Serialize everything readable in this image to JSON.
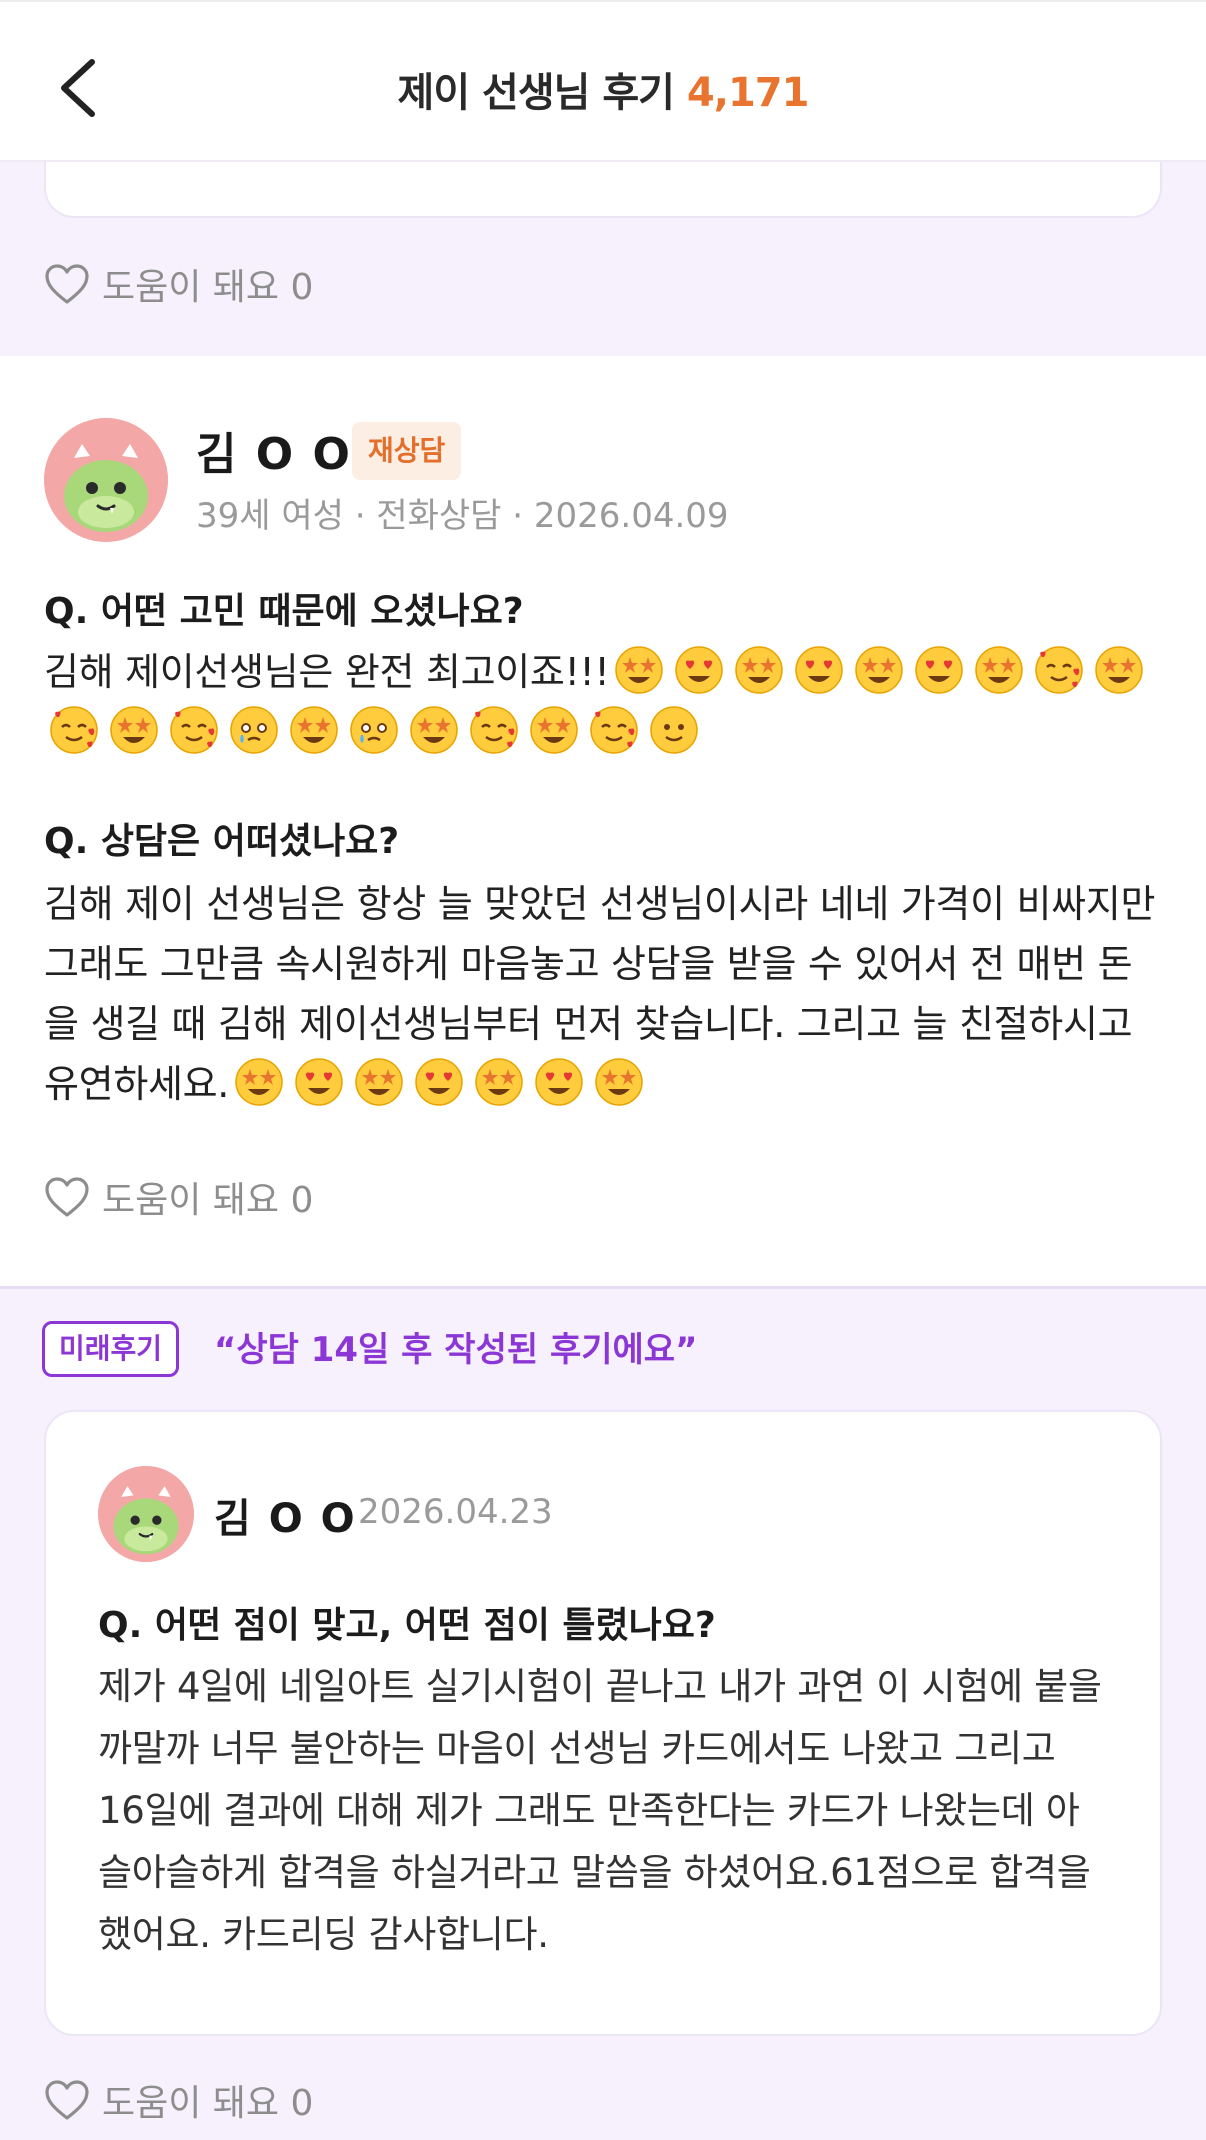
{
  "header": {
    "title": "제이 선생님 후기",
    "count": "4,171"
  },
  "prev_review": {
    "helpful_label": "도움이 돼요 0"
  },
  "review": {
    "name": "김 O O",
    "badge": "재상담",
    "meta": "39세 여성 · 전화상담 · 2026.04.09",
    "q1": "Q. 어떤 고민 때문에 오셨나요?",
    "a1": "김해 제이선생님은 완전 최고이죠!!!",
    "a1_emojis": [
      "star-struck",
      "heart-eyes",
      "star-struck",
      "heart-eyes",
      "star-struck",
      "heart-eyes",
      "star-struck",
      "smiling-hearts",
      "star-struck",
      "smiling-hearts",
      "star-struck",
      "smiling-hearts",
      "holding-tears",
      "star-struck",
      "holding-tears",
      "star-struck",
      "smiling-hearts",
      "star-struck",
      "smiling-hearts",
      "slight-smile"
    ],
    "q2": "Q. 상담은 어떠셨나요?",
    "a2": "김해 제이 선생님은 항상 늘 맞았던 선생님이시라 네네 가격이 비싸지만 그래도 그만큼 속시원하게 마음놓고 상담을 받을 수 있어서 전 매번 돈을 생길 때 김해 제이선생님부터 먼저 찾습니다. 그리고 늘 친절하시고 유연하세요.",
    "a2_emojis": [
      "star-struck",
      "heart-eyes",
      "star-struck",
      "heart-eyes",
      "star-struck",
      "heart-eyes",
      "star-struck"
    ],
    "helpful_label": "도움이 돼요 0"
  },
  "future_review": {
    "tag": "미래후기",
    "quote": "“상담 14일 후 작성된 후기에요”",
    "name": "김 O O",
    "date": "2026.04.23",
    "question": "Q. 어떤 점이 맞고, 어떤 점이 틀렸나요?",
    "answer": "제가 4일에 네일아트 실기시험이 끝나고 내가 과연 이 시험에 붙을까말까 너무 불안하는 마음이 선생님 카드에서도 나왔고 그리고 16일에 결과에 대해 제가 그래도 만족한다는 카드가 나왔는데 아슬아슬하게 합격을 하실거라고 말씀을 하셨어요.61점으로 합격을 했어요. 카드리딩 감사합니다.",
    "helpful_label": "도움이 돼요 0"
  },
  "colors": {
    "accent_orange": "#e8742f",
    "accent_purple": "#8d36d6",
    "background_lavender": "#f6f1fd"
  }
}
